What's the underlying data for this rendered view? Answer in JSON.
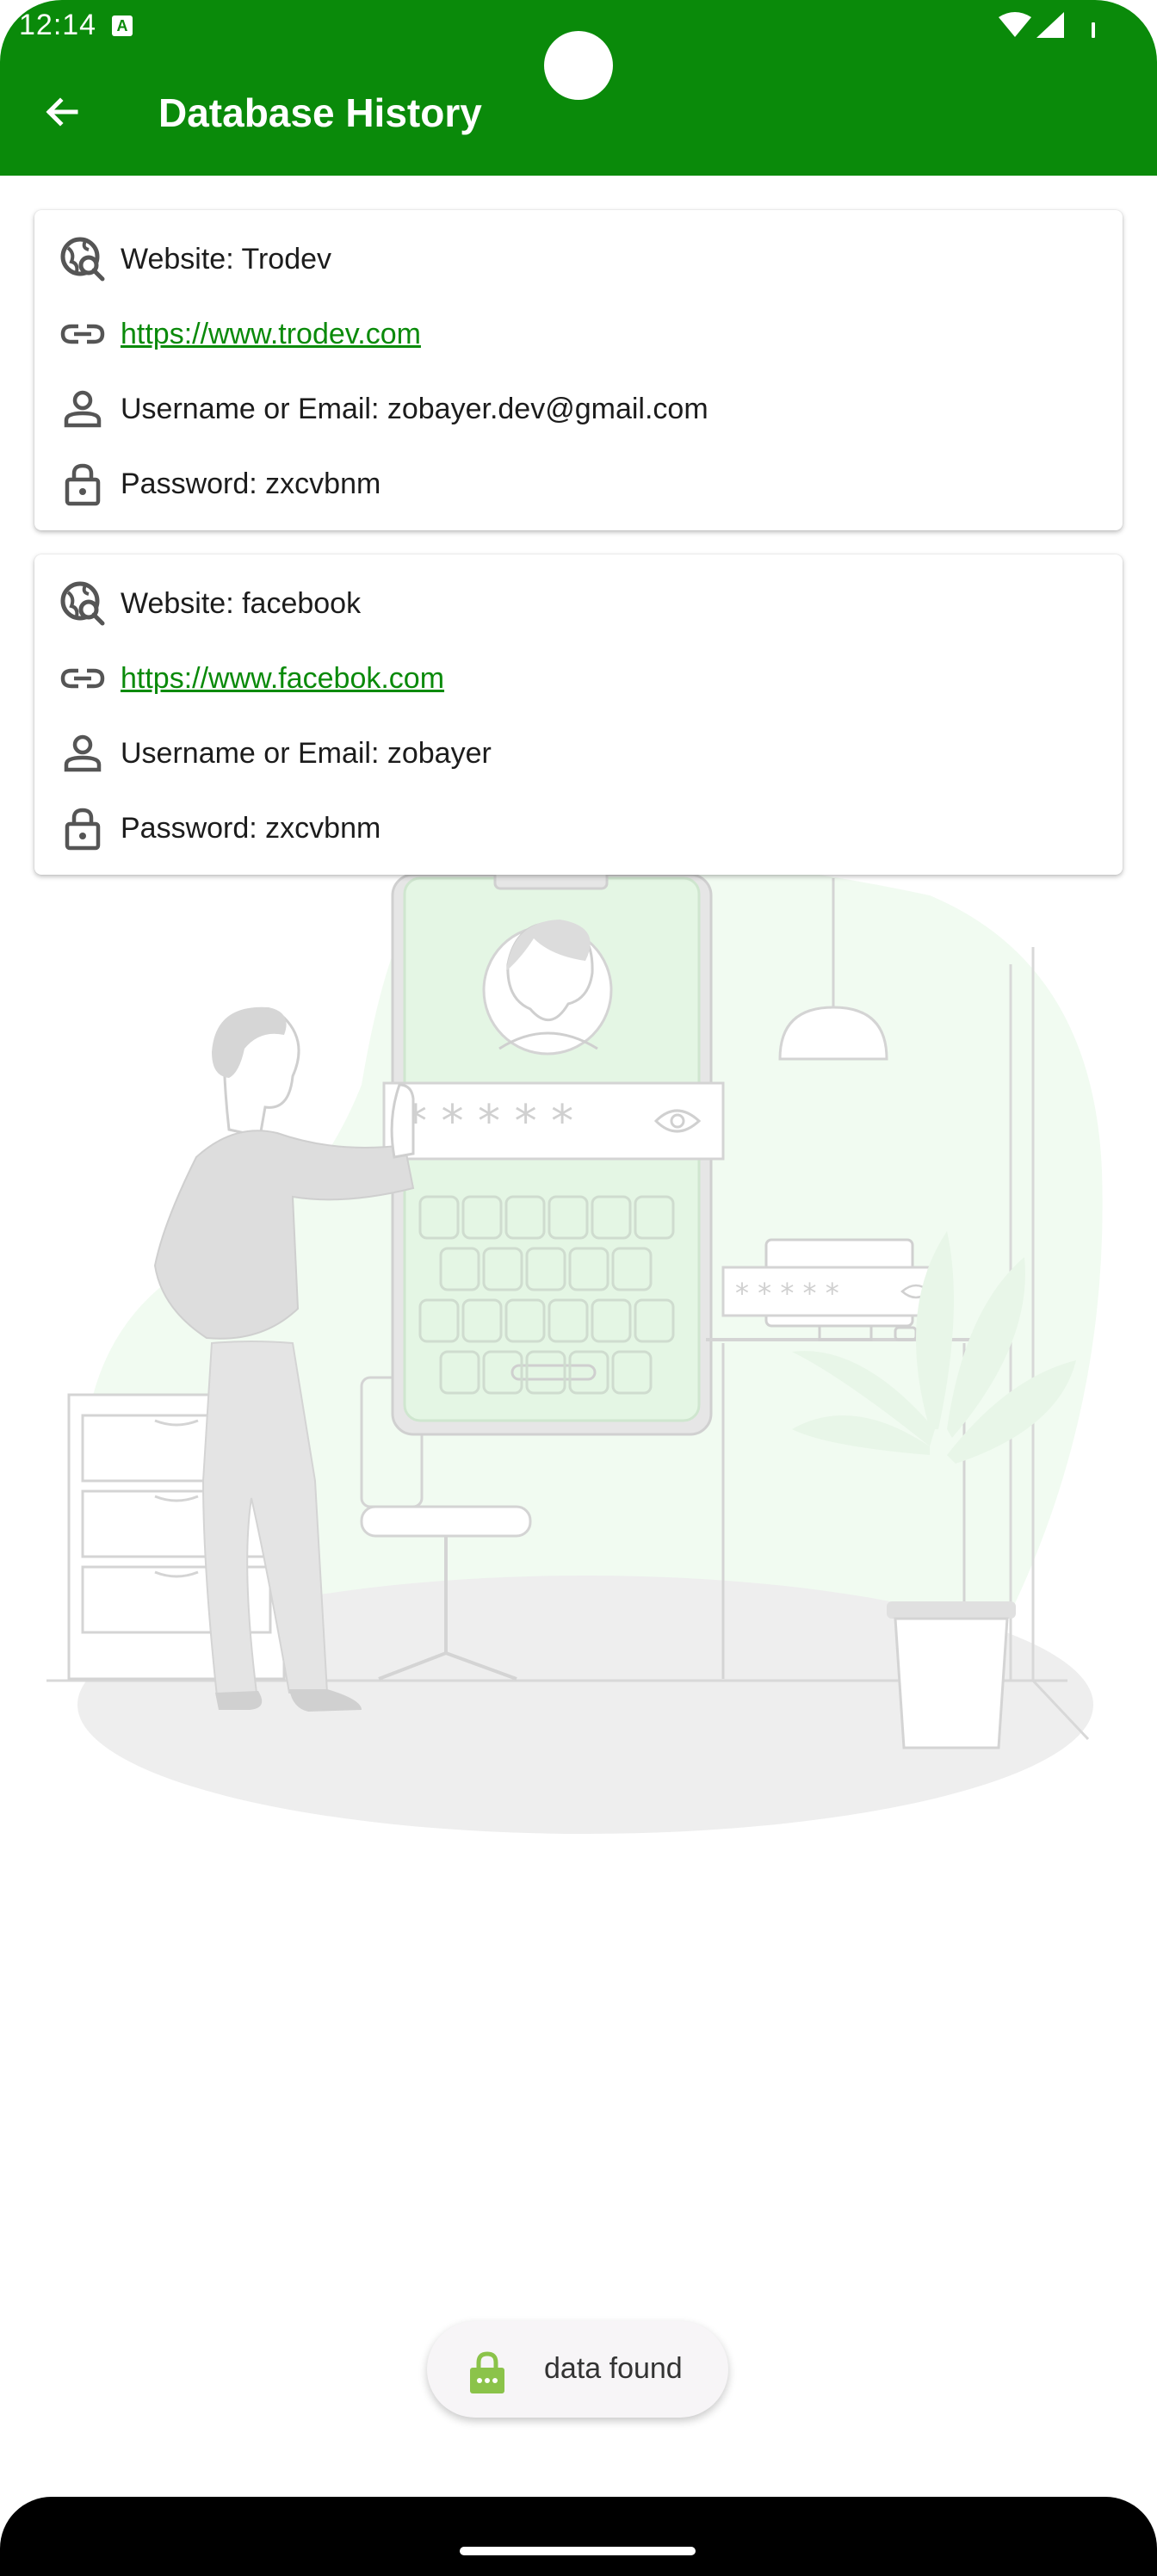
{
  "status_bar": {
    "time": "12:14",
    "notification_icon": "a-icon"
  },
  "app_bar": {
    "back_icon": "arrow-back-icon",
    "title": "Database History",
    "color": "#0a8a0a"
  },
  "entries": [
    {
      "website": "Website: Trodev",
      "url": "https://www.trodev.com",
      "username": "Username or Email: zobayer.dev@gmail.com",
      "password": "Password: zxcvbnm"
    },
    {
      "website": "Website: facebook",
      "url": "https://www.facebok.com",
      "username": "Username or Email: zobayer",
      "password": "Password: zxcvbnm"
    }
  ],
  "illustration": {
    "mask": "* * * * *",
    "monitor_mask": "* * * * *"
  },
  "toast": {
    "icon": "android-icon",
    "text": "data found"
  }
}
